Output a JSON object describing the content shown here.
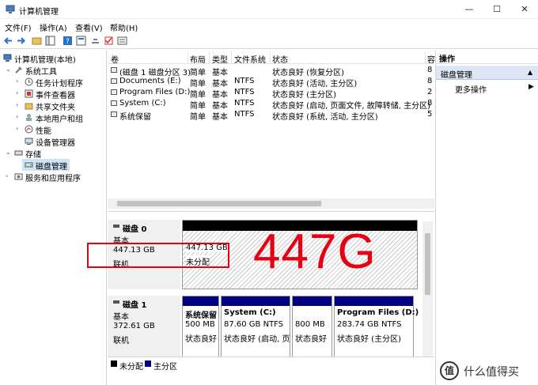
{
  "window": {
    "title": "计算机管理"
  },
  "window_controls": {
    "minimize": "—",
    "maximize": "☐",
    "close": "✕"
  },
  "menu": [
    "文件(F)",
    "操作(A)",
    "查看(V)",
    "帮助(H)"
  ],
  "tree": {
    "root": "计算机管理(本地)",
    "items": [
      {
        "label": "系统工具"
      },
      {
        "label": "任务计划程序"
      },
      {
        "label": "事件查看器"
      },
      {
        "label": "共享文件夹"
      },
      {
        "label": "本地用户和组"
      },
      {
        "label": "性能"
      },
      {
        "label": "设备管理器"
      },
      {
        "label": "存储"
      },
      {
        "label": "磁盘管理"
      },
      {
        "label": "服务和应用程序"
      }
    ]
  },
  "volumes": {
    "headers": [
      "卷",
      "布局",
      "类型",
      "文件系统",
      "状态",
      "容"
    ],
    "rows": [
      [
        "(磁盘 1 磁盘分区 3)",
        "简单",
        "基本",
        "",
        "状态良好 (恢复分区)",
        "8"
      ],
      [
        "Documents (E:)",
        "简单",
        "基本",
        "NTFS",
        "状态良好 (活动, 主分区)",
        "8"
      ],
      [
        "Program Files (D:)",
        "简单",
        "基本",
        "NTFS",
        "状态良好 (主分区)",
        "2"
      ],
      [
        "System (C:)",
        "简单",
        "基本",
        "NTFS",
        "状态良好 (启动, 页面文件, 故障转储, 主分区)",
        "8"
      ],
      [
        "系统保留",
        "简单",
        "基本",
        "NTFS",
        "状态良好 (系统, 活动, 主分区)",
        "5"
      ]
    ]
  },
  "disks": {
    "disk0": {
      "name": "磁盘 0",
      "type": "基本",
      "size": "447.13 GB",
      "status": "联机",
      "partition": {
        "size": "447.13 GB",
        "state": "未分配"
      }
    },
    "disk1": {
      "name": "磁盘 1",
      "type": "基本",
      "size": "372.61 GB",
      "status": "联机",
      "partitions": [
        {
          "name": "系统保留",
          "size": "500 MB",
          "status": "状态良好"
        },
        {
          "name": "System  (C:)",
          "size": "87.60 GB NTFS",
          "status": "状态良好 (启动, 页"
        },
        {
          "name": "",
          "size": "800 MB",
          "status": "状态良好"
        },
        {
          "name": "Program Files  (D:)",
          "size": "283.74 GB NTFS",
          "status": "状态良好 (主分区)"
        }
      ]
    }
  },
  "legend": [
    {
      "label": "未分配",
      "color": "#000000"
    },
    {
      "label": "主分区",
      "color": "#000080"
    }
  ],
  "annotation": {
    "text": "447G",
    "color": "#e60012"
  },
  "actions": {
    "header": "操作",
    "section": "磁盘管理",
    "item": "更多操作"
  },
  "watermark": {
    "icon_text": "值",
    "text": "什么值得买"
  }
}
